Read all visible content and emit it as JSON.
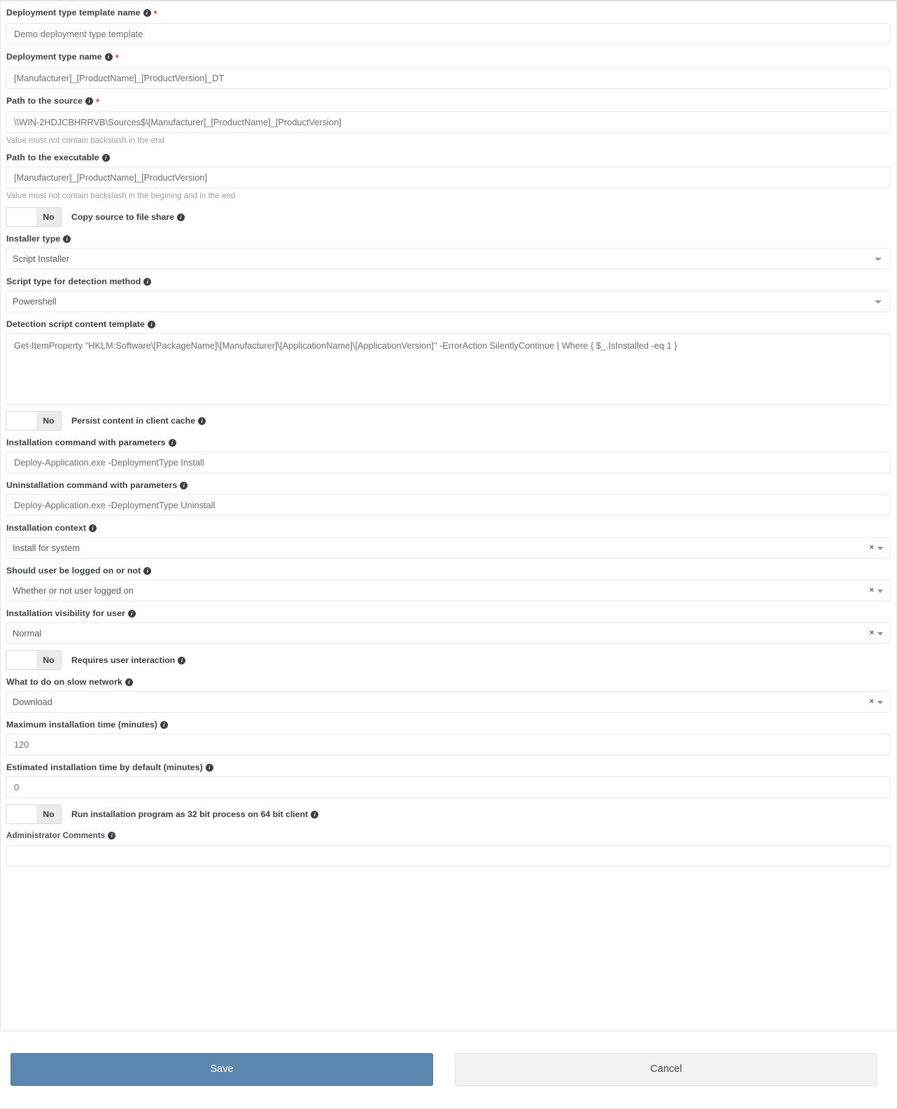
{
  "form": {
    "fields": [
      {
        "key": "deployment_type_template_name",
        "name": "deployment-type-template-name",
        "label": "Deployment type template name",
        "info": true,
        "required": true,
        "type": "text",
        "value": "Demo deployment type template",
        "hint": ""
      },
      {
        "key": "deployment_type_name",
        "name": "deployment-type-name",
        "label": "Deployment type name",
        "info": true,
        "required": true,
        "type": "text",
        "value": "[Manufacturer]_[ProductName]_[ProductVersion]_DT",
        "hint": ""
      },
      {
        "key": "path_to_the_source",
        "name": "path-to-the-source",
        "label": "Path to the source",
        "info": true,
        "required": true,
        "type": "text",
        "value": "\\\\WIN-2HDJCBHRRVB\\Sources$\\[Manufacturer]_[ProductName]_[ProductVersion]",
        "hint": "Value must not contain backslash in the end"
      },
      {
        "key": "path_to_the_executable",
        "name": "path-to-the-executable",
        "label": "Path to the executable",
        "info": true,
        "required": false,
        "type": "text",
        "value": "[Manufacturer]_[ProductName]_[ProductVersion]",
        "hint": "Value must not contain backslash in the begining and in the end"
      },
      {
        "key": "copy_source_to_file_share",
        "name": "copy-source-to-file-share",
        "label": "Copy source to file share",
        "info": true,
        "required": false,
        "type": "toggle",
        "value": "No",
        "hint": ""
      },
      {
        "key": "installer_type",
        "name": "installer-type",
        "label": "Installer type",
        "info": true,
        "required": false,
        "type": "select",
        "value": "Script Installer",
        "clearable": false,
        "hint": ""
      },
      {
        "key": "script_type_for_detection_method",
        "name": "script-type-for-detection-method",
        "label": "Script type for detection method",
        "info": true,
        "required": false,
        "type": "select",
        "value": "Powershell",
        "clearable": false,
        "hint": ""
      },
      {
        "key": "detection_script_content_template",
        "name": "detection-script-content-template",
        "label": "Detection script content template",
        "info": true,
        "required": false,
        "type": "textarea",
        "value": "Get-ItemProperty \"HKLM:Software\\[PackageName]\\[Manufacturer]\\[ApplicationName]\\[ApplicationVersion]\" -ErrorAction SilentlyContinue | Where { $_.IsInstalled -eq 1 }",
        "hint": ""
      },
      {
        "key": "persist_content_in_client_cache",
        "name": "persist-content-in-client-cache",
        "label": "Persist content in client cache",
        "info": true,
        "required": false,
        "type": "toggle",
        "value": "No",
        "hint": ""
      },
      {
        "key": "installation_command_with_parameters",
        "name": "installation-command-with-parameters",
        "label": "Installation command with parameters",
        "info": true,
        "required": false,
        "type": "text",
        "value": "Deploy-Application.exe -DeploymentType Install",
        "hint": ""
      },
      {
        "key": "uninstallation_command_with_parameters",
        "name": "uninstallation-command-with-parameters",
        "label": "Uninstallation command with parameters",
        "info": true,
        "required": false,
        "type": "text",
        "value": "Deploy-Application.exe -DeploymentType Uninstall",
        "hint": ""
      },
      {
        "key": "installation_context",
        "name": "installation-context",
        "label": "Installation context",
        "info": true,
        "required": false,
        "type": "select",
        "value": "Install for system",
        "clearable": true,
        "hint": ""
      },
      {
        "key": "should_user_be_logged_on_or_not",
        "name": "should-user-be-logged-on-or-not",
        "label": "Should user be logged on or not",
        "info": true,
        "required": false,
        "type": "select",
        "value": "Whether or not user logged on",
        "clearable": true,
        "hint": ""
      },
      {
        "key": "installation_visibility_for_user",
        "name": "installation-visibility-for-user",
        "label": "Installation visibility for user",
        "info": true,
        "required": false,
        "type": "select",
        "value": "Normal",
        "clearable": true,
        "hint": ""
      },
      {
        "key": "requires_user_interaction",
        "name": "requires-user-interaction",
        "label": "Requires user interaction",
        "info": true,
        "required": false,
        "type": "toggle",
        "value": "No",
        "hint": ""
      },
      {
        "key": "what_to_do_on_slow_network",
        "name": "what-to-do-on-slow-network",
        "label": "What to do on slow network",
        "info": true,
        "required": false,
        "type": "select",
        "value": "Download",
        "clearable": true,
        "hint": ""
      },
      {
        "key": "maximum_installation_time",
        "name": "maximum-installation-time",
        "label": "Maximum installation time (minutes)",
        "info": true,
        "required": false,
        "type": "text",
        "value": "120",
        "hint": ""
      },
      {
        "key": "estimated_installation_time_by_default",
        "name": "estimated-installation-time-by-default",
        "label": "Estimated installation time by default (minutes)",
        "info": true,
        "required": false,
        "type": "text",
        "value": "0",
        "hint": ""
      },
      {
        "key": "run_installation_program_as_32_bit",
        "name": "run-installation-program-as-32-bit-process",
        "label": "Run installation program as 32 bit process on 64 bit client",
        "info": true,
        "required": false,
        "type": "toggle",
        "value": "No",
        "hint": ""
      },
      {
        "key": "administrator_comments",
        "name": "administrator-comments",
        "label": "Administrator Comments",
        "info": true,
        "required": false,
        "type": "text",
        "value": "",
        "small_label": true,
        "hint": ""
      }
    ]
  },
  "footer": {
    "save_label": "Save",
    "cancel_label": "Cancel"
  },
  "icons": {
    "info": "i",
    "clear": "×"
  },
  "colors": {
    "save_button": "#5b87ae",
    "required_asterisk": "#e5452f",
    "label_text": "#3b3f44",
    "input_text": "#6c7076",
    "hint_text": "#9a9ea4",
    "border": "#e9e9ec"
  }
}
